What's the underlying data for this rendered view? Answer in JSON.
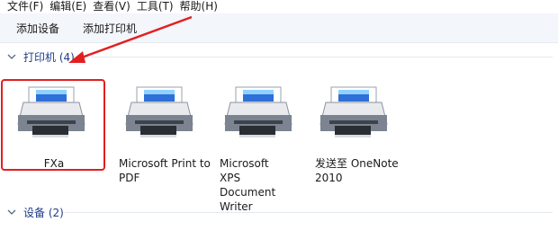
{
  "menu": {
    "items": [
      "文件(F)",
      "编辑(E)",
      "查看(V)",
      "工具(T)",
      "帮助(H)"
    ]
  },
  "toolbar": {
    "add_device": "添加设备",
    "add_printer": "添加打印机"
  },
  "groups": {
    "printers": {
      "label": "打印机 (4)",
      "expanded": true
    },
    "devices": {
      "label": "设备 (2)",
      "expanded": true
    }
  },
  "printers": [
    {
      "name": "FXa",
      "selected": true,
      "icon": "printer-icon"
    },
    {
      "name": "Microsoft Print to PDF",
      "selected": false,
      "icon": "printer-icon"
    },
    {
      "name": "Microsoft XPS Document Writer",
      "selected": false,
      "icon": "printer-icon"
    },
    {
      "name": "发送至 OneNote 2010",
      "selected": false,
      "icon": "printer-icon"
    }
  ],
  "colors": {
    "accent": "#1f3c88",
    "annotation": "#e21f1f",
    "toolbar_bg": "#f3f6fb"
  }
}
